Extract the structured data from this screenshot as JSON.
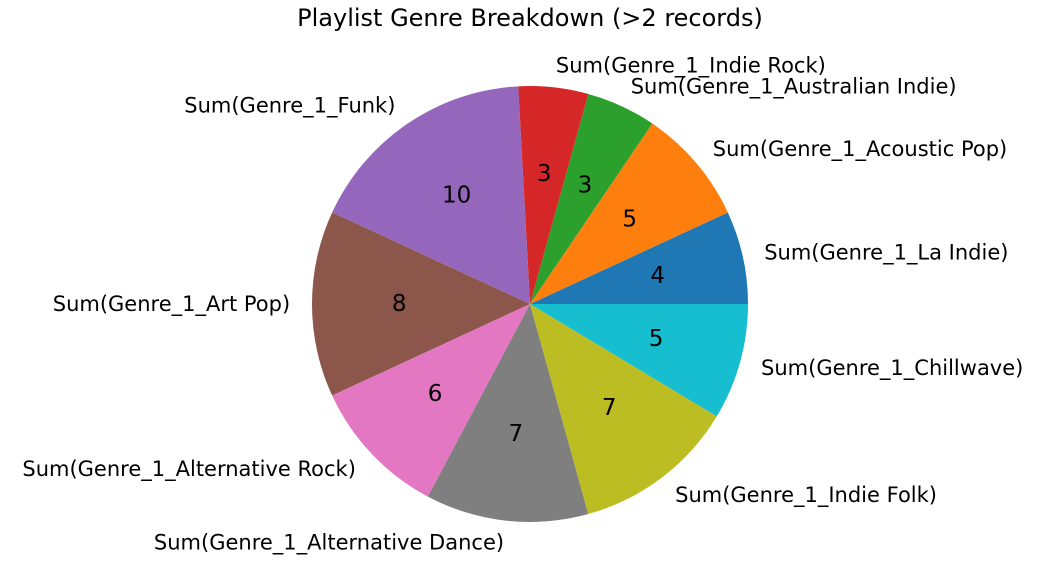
{
  "chart_data": {
    "type": "pie",
    "title": "Playlist Genre Breakdown (>2 records)",
    "slices": [
      {
        "label": "Sum(Genre_1_La Indie)",
        "value": 4,
        "color": "#1f77b4"
      },
      {
        "label": "Sum(Genre_1_Acoustic Pop)",
        "value": 5,
        "color": "#ff7f0e"
      },
      {
        "label": "Sum(Genre_1_Australian Indie)",
        "value": 3,
        "color": "#2ca02c"
      },
      {
        "label": "Sum(Genre_1_Indie Rock)",
        "value": 3,
        "color": "#d62728"
      },
      {
        "label": "Sum(Genre_1_Funk)",
        "value": 10,
        "color": "#9467bd"
      },
      {
        "label": "Sum(Genre_1_Art Pop)",
        "value": 8,
        "color": "#8c564b"
      },
      {
        "label": "Sum(Genre_1_Alternative Rock)",
        "value": 6,
        "color": "#e377c2"
      },
      {
        "label": "Sum(Genre_1_Alternative Dance)",
        "value": 7,
        "color": "#7f7f7f"
      },
      {
        "label": "Sum(Genre_1_Indie Folk)",
        "value": 7,
        "color": "#bcbd22"
      },
      {
        "label": "Sum(Genre_1_Chillwave)",
        "value": 5,
        "color": "#17becf"
      }
    ]
  }
}
